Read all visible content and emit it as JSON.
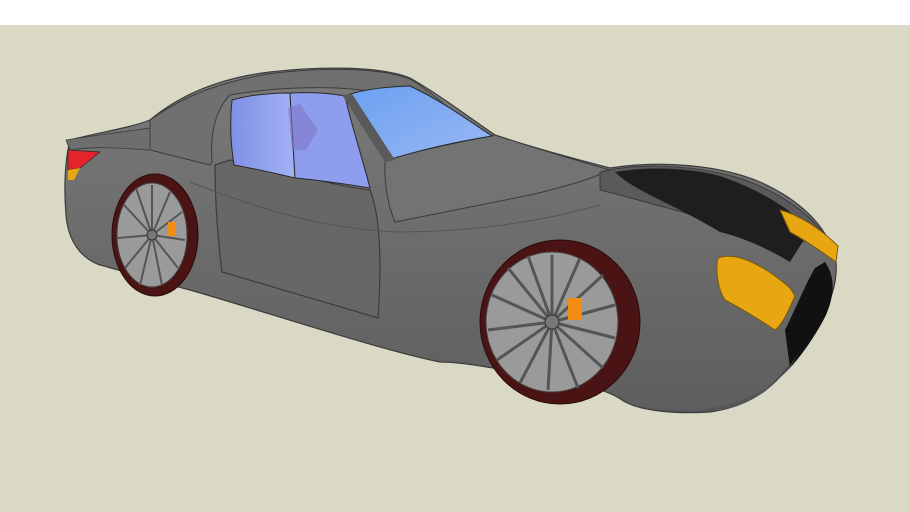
{
  "scene": {
    "sky_color": "#ffffff",
    "ground_color": "#d9d9c6",
    "model": "sports-coupe-3d-model"
  },
  "car": {
    "body_color": "#6a6a6a",
    "edge_color": "#3c3c3c",
    "window_tint": "#8ea7f2",
    "headlight_color": "#e8a612",
    "taillight_color": "#e6222a",
    "tire_color": "#4a1414",
    "rim_color": "#9a9a9a",
    "brake_caliper_color": "#f28c12",
    "grille_color": "#111111"
  }
}
